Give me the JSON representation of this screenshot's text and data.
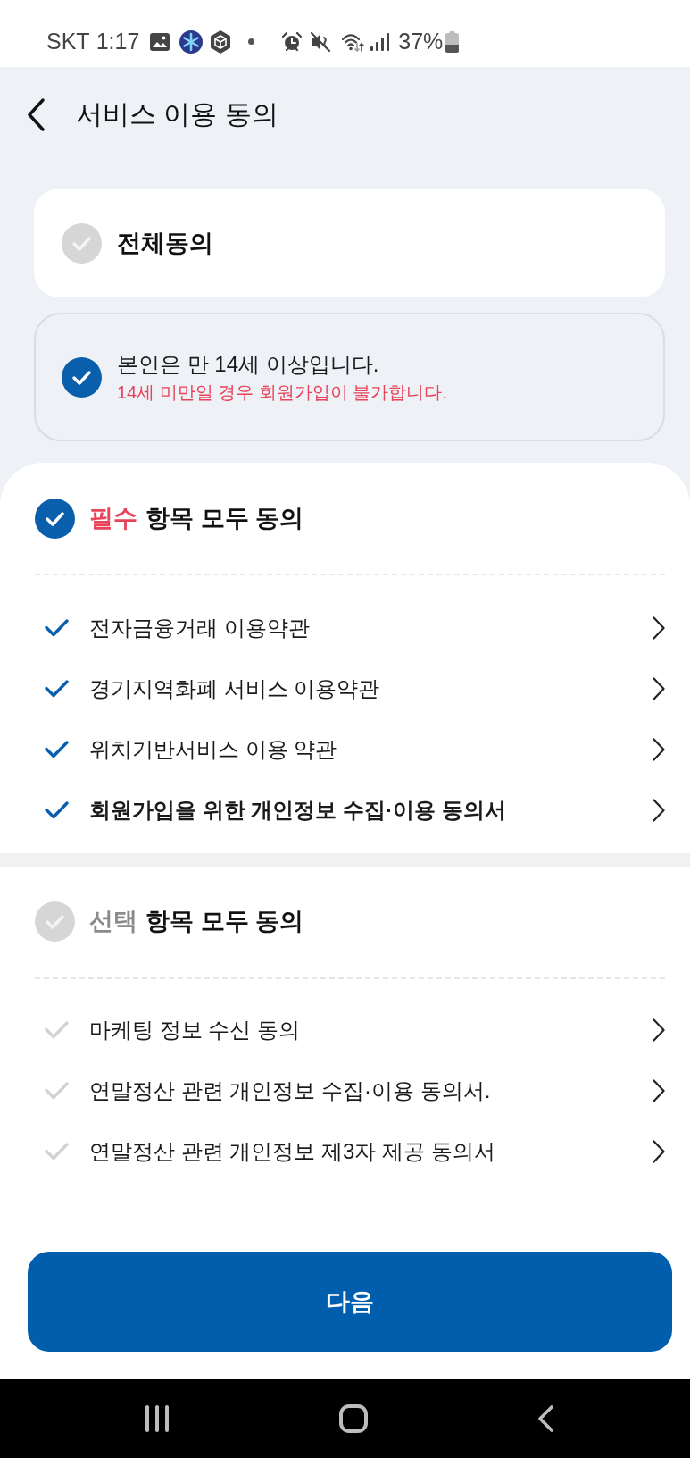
{
  "status_bar": {
    "carrier": "SKT",
    "time": "1:17",
    "battery": "37%"
  },
  "header": {
    "title": "서비스 이용 동의"
  },
  "agree_all": {
    "label": "전체동의",
    "checked": false
  },
  "age_confirm": {
    "label": "본인은 만 14세 이상입니다.",
    "note": "14세 미만일 경우 회원가입이 불가합니다.",
    "checked": true
  },
  "sections": [
    {
      "kind": "required",
      "tag": "필수",
      "title": "항목 모두 동의",
      "checked": true,
      "items": [
        {
          "label": "전자금융거래 이용약관",
          "checked": true,
          "emphasized": false
        },
        {
          "label": "경기지역화폐 서비스 이용약관",
          "checked": true,
          "emphasized": false
        },
        {
          "label": "위치기반서비스 이용 약관",
          "checked": true,
          "emphasized": false
        },
        {
          "label": "회원가입을 위한 개인정보 수집·이용 동의서",
          "checked": true,
          "emphasized": true
        }
      ]
    },
    {
      "kind": "optional",
      "tag": "선택",
      "title": "항목 모두 동의",
      "checked": false,
      "items": [
        {
          "label": "마케팅 정보 수신 동의",
          "checked": false,
          "emphasized": false
        },
        {
          "label": "연말정산 관련 개인정보 수집·이용 동의서.",
          "checked": false,
          "emphasized": false
        },
        {
          "label": "연말정산 관련 개인정보 제3자 제공 동의서",
          "checked": false,
          "emphasized": false
        }
      ]
    }
  ],
  "next_button": {
    "label": "다음"
  }
}
